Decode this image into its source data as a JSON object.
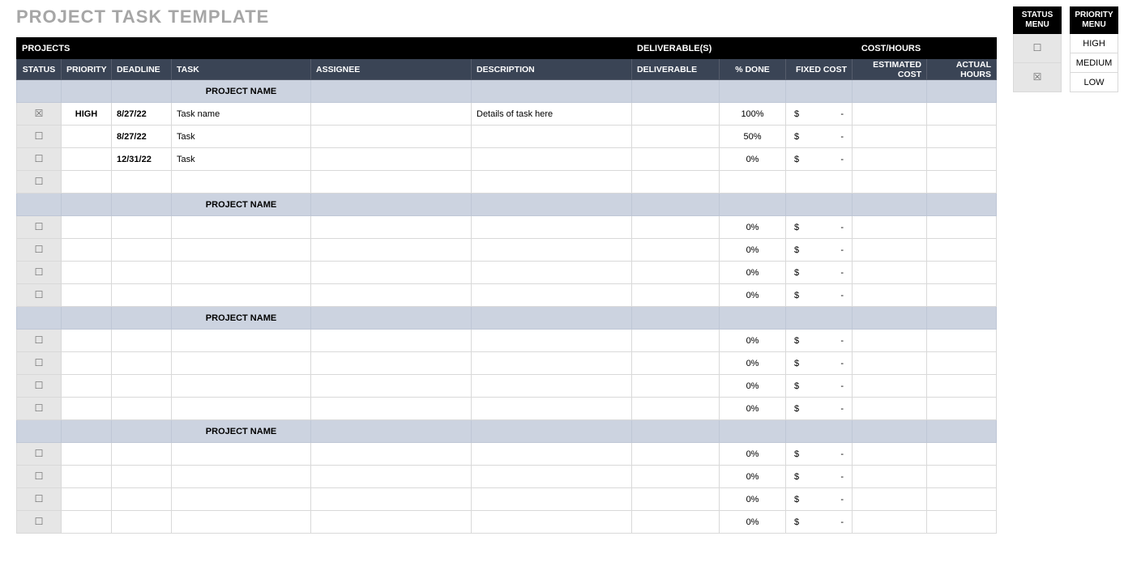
{
  "title": "PROJECT TASK TEMPLATE",
  "band": {
    "projects": "PROJECTS",
    "deliverables": "DELIVERABLE(S)",
    "cost_hours": "COST/HOURS"
  },
  "headers": {
    "status": "STATUS",
    "priority": "PRIORITY",
    "deadline": "DEADLINE",
    "task": "TASK",
    "assignee": "ASSIGNEE",
    "description": "DESCRIPTION",
    "deliverable": "DELIVERABLE",
    "pct_done": "% DONE",
    "fixed_cost": "FIXED COST",
    "est_cost": "ESTIMATED COST",
    "actual_hours": "ACTUAL HOURS"
  },
  "glyph": {
    "unchecked": "☐",
    "checked": "☒",
    "dollar": "$",
    "dash": "-"
  },
  "projects": [
    {
      "name": "PROJECT NAME",
      "rows": [
        {
          "checked": true,
          "priority": "HIGH",
          "deadline": "8/27/22",
          "task": "Task name",
          "assignee": "",
          "description": "Details of task here",
          "deliverable": "",
          "pct_done": "100%",
          "cost": true,
          "est_cost": "",
          "actual_hours": ""
        },
        {
          "checked": false,
          "priority": "",
          "deadline": "8/27/22",
          "task": "Task",
          "assignee": "",
          "description": "",
          "deliverable": "",
          "pct_done": "50%",
          "cost": true,
          "est_cost": "",
          "actual_hours": ""
        },
        {
          "checked": false,
          "priority": "",
          "deadline": "12/31/22",
          "task": "Task",
          "assignee": "",
          "description": "",
          "deliverable": "",
          "pct_done": "0%",
          "cost": true,
          "est_cost": "",
          "actual_hours": ""
        },
        {
          "checked": false,
          "priority": "",
          "deadline": "",
          "task": "",
          "assignee": "",
          "description": "",
          "deliverable": "",
          "pct_done": "",
          "cost": false,
          "est_cost": "",
          "actual_hours": ""
        }
      ]
    },
    {
      "name": "PROJECT NAME",
      "rows": [
        {
          "checked": false,
          "priority": "",
          "deadline": "",
          "task": "",
          "assignee": "",
          "description": "",
          "deliverable": "",
          "pct_done": "0%",
          "cost": true,
          "est_cost": "",
          "actual_hours": ""
        },
        {
          "checked": false,
          "priority": "",
          "deadline": "",
          "task": "",
          "assignee": "",
          "description": "",
          "deliverable": "",
          "pct_done": "0%",
          "cost": true,
          "est_cost": "",
          "actual_hours": ""
        },
        {
          "checked": false,
          "priority": "",
          "deadline": "",
          "task": "",
          "assignee": "",
          "description": "",
          "deliverable": "",
          "pct_done": "0%",
          "cost": true,
          "est_cost": "",
          "actual_hours": ""
        },
        {
          "checked": false,
          "priority": "",
          "deadline": "",
          "task": "",
          "assignee": "",
          "description": "",
          "deliverable": "",
          "pct_done": "0%",
          "cost": true,
          "est_cost": "",
          "actual_hours": ""
        }
      ]
    },
    {
      "name": "PROJECT NAME",
      "rows": [
        {
          "checked": false,
          "priority": "",
          "deadline": "",
          "task": "",
          "assignee": "",
          "description": "",
          "deliverable": "",
          "pct_done": "0%",
          "cost": true,
          "est_cost": "",
          "actual_hours": ""
        },
        {
          "checked": false,
          "priority": "",
          "deadline": "",
          "task": "",
          "assignee": "",
          "description": "",
          "deliverable": "",
          "pct_done": "0%",
          "cost": true,
          "est_cost": "",
          "actual_hours": ""
        },
        {
          "checked": false,
          "priority": "",
          "deadline": "",
          "task": "",
          "assignee": "",
          "description": "",
          "deliverable": "",
          "pct_done": "0%",
          "cost": true,
          "est_cost": "",
          "actual_hours": ""
        },
        {
          "checked": false,
          "priority": "",
          "deadline": "",
          "task": "",
          "assignee": "",
          "description": "",
          "deliverable": "",
          "pct_done": "0%",
          "cost": true,
          "est_cost": "",
          "actual_hours": ""
        }
      ]
    },
    {
      "name": "PROJECT NAME",
      "rows": [
        {
          "checked": false,
          "priority": "",
          "deadline": "",
          "task": "",
          "assignee": "",
          "description": "",
          "deliverable": "",
          "pct_done": "0%",
          "cost": true,
          "est_cost": "",
          "actual_hours": ""
        },
        {
          "checked": false,
          "priority": "",
          "deadline": "",
          "task": "",
          "assignee": "",
          "description": "",
          "deliverable": "",
          "pct_done": "0%",
          "cost": true,
          "est_cost": "",
          "actual_hours": ""
        },
        {
          "checked": false,
          "priority": "",
          "deadline": "",
          "task": "",
          "assignee": "",
          "description": "",
          "deliverable": "",
          "pct_done": "0%",
          "cost": true,
          "est_cost": "",
          "actual_hours": ""
        },
        {
          "checked": false,
          "priority": "",
          "deadline": "",
          "task": "",
          "assignee": "",
          "description": "",
          "deliverable": "",
          "pct_done": "0%",
          "cost": true,
          "est_cost": "",
          "actual_hours": ""
        }
      ]
    }
  ],
  "status_menu": {
    "title": "STATUS MENU",
    "items": [
      {
        "glyph": "unchecked"
      },
      {
        "glyph": "checked"
      }
    ]
  },
  "priority_menu": {
    "title": "PRIORITY MENU",
    "items": [
      "HIGH",
      "MEDIUM",
      "LOW"
    ]
  }
}
